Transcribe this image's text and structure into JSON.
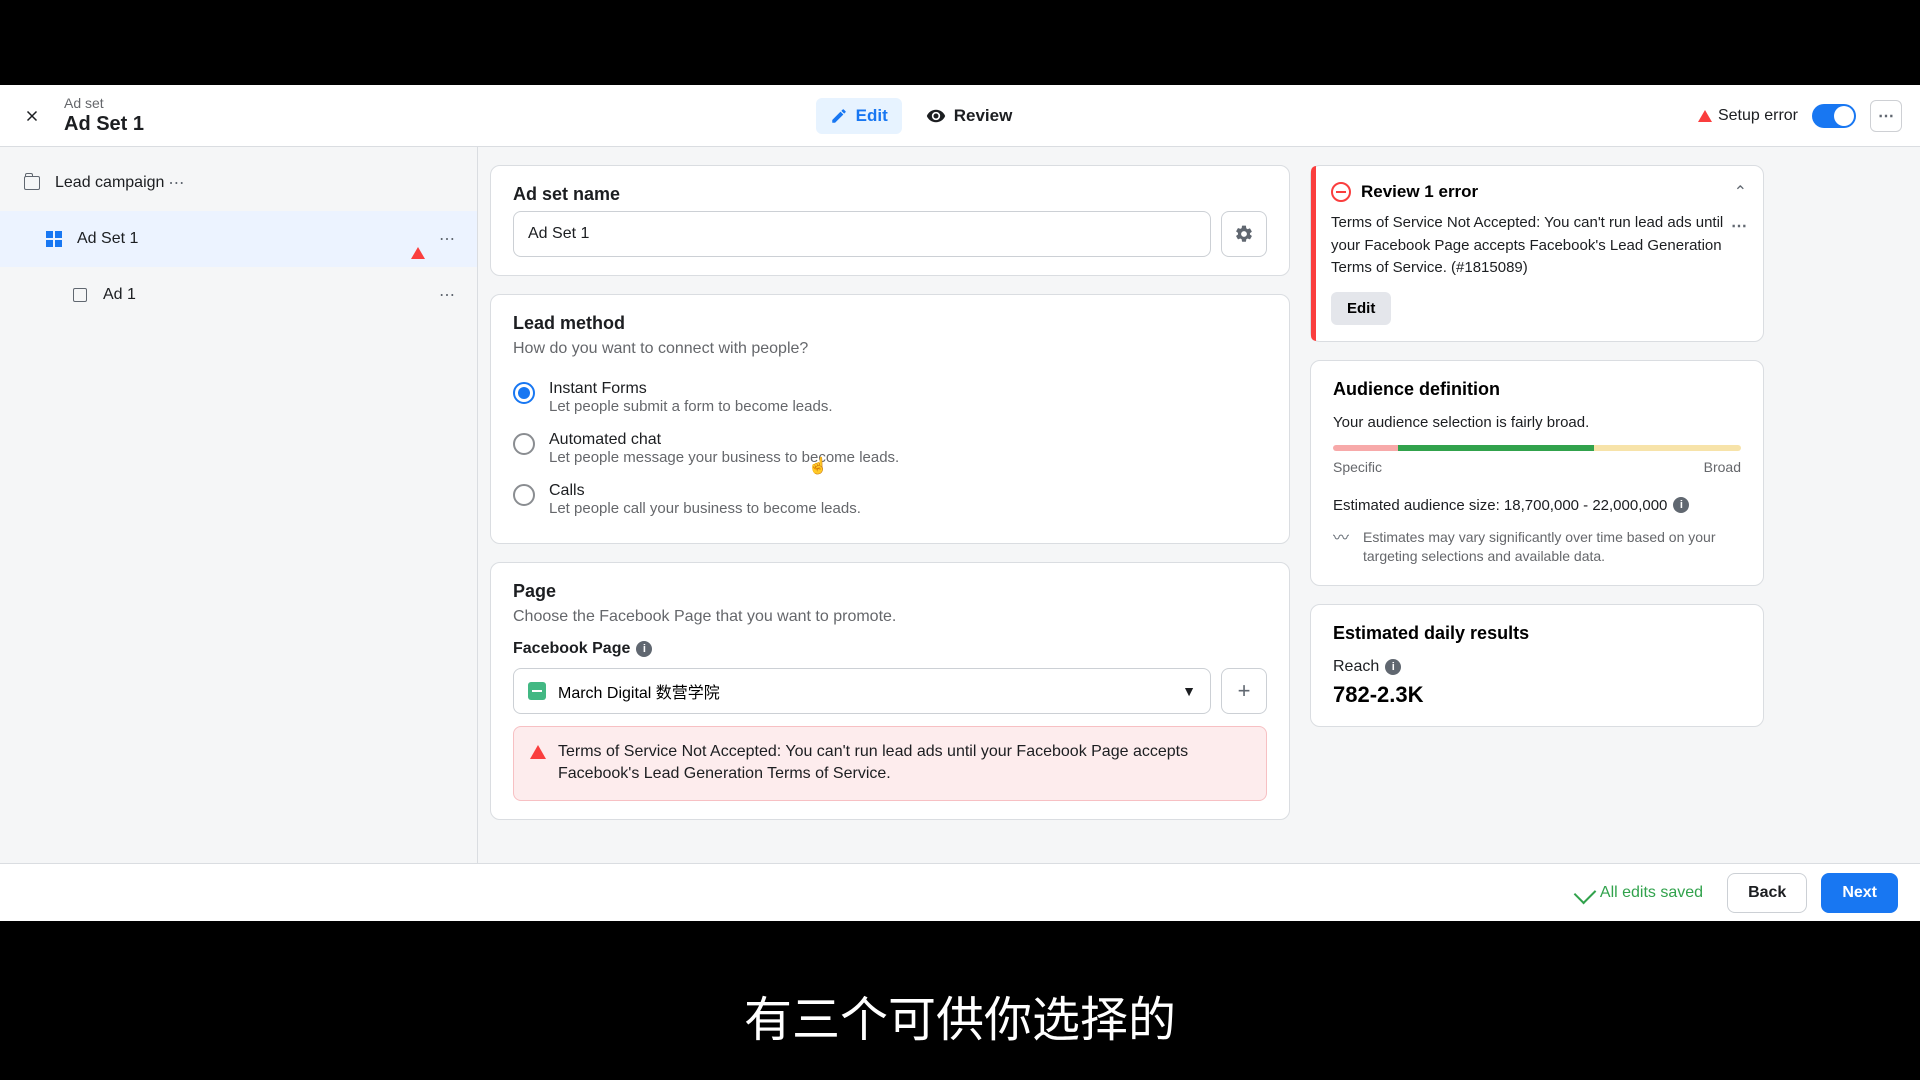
{
  "header": {
    "breadcrumb": "Ad set",
    "title": "Ad Set 1",
    "edit_label": "Edit",
    "review_label": "Review",
    "setup_error_label": "Setup error"
  },
  "sidebar": {
    "campaign": "Lead campaign",
    "adset": "Ad Set 1",
    "ad": "Ad 1"
  },
  "adset_name": {
    "label": "Ad set name",
    "value": "Ad Set 1"
  },
  "lead_method": {
    "title": "Lead method",
    "subtitle": "How do you want to connect with people?",
    "options": [
      {
        "title": "Instant Forms",
        "desc": "Let people submit a form to become leads."
      },
      {
        "title": "Automated chat",
        "desc": "Let people message your business to become leads."
      },
      {
        "title": "Calls",
        "desc": "Let people call your business to become leads."
      }
    ]
  },
  "page": {
    "title": "Page",
    "subtitle": "Choose the Facebook Page that you want to promote.",
    "field_label": "Facebook Page",
    "selected": "March Digital 数营学院",
    "error": "Terms of Service Not Accepted: You can't run lead ads until your Facebook Page accepts Facebook's Lead Generation Terms of Service."
  },
  "review_error": {
    "title": "Review 1 error",
    "body": "Terms of Service Not Accepted: You can't run lead ads until your Facebook Page accepts Facebook's Lead Generation Terms of Service. (#1815089)",
    "edit_label": "Edit"
  },
  "audience": {
    "title": "Audience definition",
    "status": "Your audience selection is fairly broad.",
    "specific_label": "Specific",
    "broad_label": "Broad",
    "size_text": "Estimated audience size: 18,700,000 - 22,000,000",
    "note": "Estimates may vary significantly over time based on your targeting selections and available data."
  },
  "estimated": {
    "title": "Estimated daily results",
    "reach_label": "Reach",
    "reach_value": "782-2.3K"
  },
  "footer": {
    "saved": "All edits saved",
    "back": "Back",
    "next": "Next"
  },
  "subtitle": "有三个可供你选择的"
}
